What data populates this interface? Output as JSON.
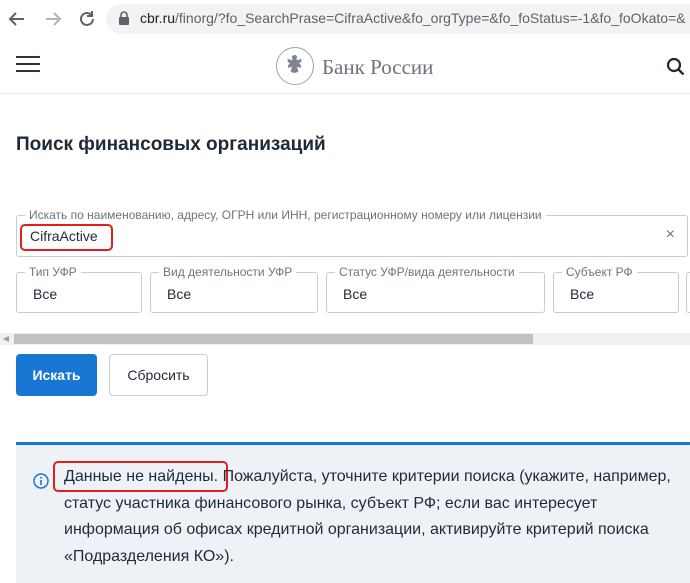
{
  "browser": {
    "back_icon": "arrow-left-icon",
    "forward_icon": "arrow-right-icon",
    "reload_icon": "reload-icon",
    "lock_icon": "lock-icon",
    "url_host": "cbr.ru",
    "url_path": "/finorg/?fo_SearchPrase=CifraActive&fo_orgType=&fo_foStatus=-1&fo_foOkato=&"
  },
  "header": {
    "menu_icon": "hamburger-icon",
    "logo_text": "Банк России",
    "search_icon": "search-icon"
  },
  "page": {
    "title": "Поиск финансовых организаций"
  },
  "search": {
    "legend": "Искать по наименованию, адресу, ОГРН или ИНН, регистрационному номеру или лицензии",
    "value": "CifraActive",
    "clear": "×"
  },
  "filters": [
    {
      "label": "Тип УФР",
      "value": "Все"
    },
    {
      "label": "Вид деятельности УФР",
      "value": "Все"
    },
    {
      "label": "Статус УФР/вида деятельности",
      "value": "Все"
    },
    {
      "label": "Субъект РФ",
      "value": "Все"
    }
  ],
  "actions": {
    "search_label": "Искать",
    "reset_label": "Сбросить"
  },
  "notice": {
    "icon": "info-icon",
    "highlight": "Данные не найдены.",
    "message": " Пожалуйста, уточните критерии поиска (укажите, например, статус участника финансового рынка, субъект РФ; если вас интересует информация об офисах кредитной организации, активируйте критерий поиска «Подразделения КО»)."
  },
  "colors": {
    "accent": "#1877d2",
    "highlight_border": "#e02020",
    "notice_bg": "#eef2f6"
  }
}
